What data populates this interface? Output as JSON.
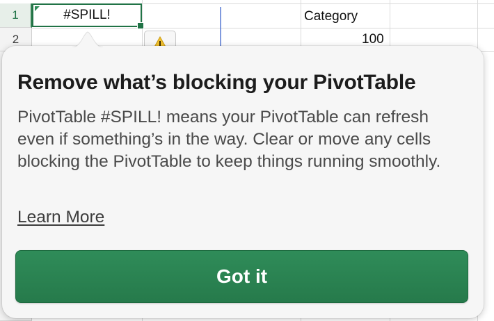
{
  "sheet": {
    "row_numbers": [
      "1",
      "2"
    ],
    "active_cell_value": "#SPILL!",
    "header_cell": "Category",
    "value_cell": "100"
  },
  "icons": {
    "warning": "warning-icon"
  },
  "callout": {
    "title": "Remove what’s blocking your PivotTable",
    "body": "PivotTable #SPILL! means your PivotTable can refresh even if something’s in the way. Clear or move any cells blocking the PivotTable to keep things running smoothly.",
    "learn_more": "Learn More",
    "button": "Got it"
  },
  "colors": {
    "accent": "#217346",
    "button": "#2a7f4f",
    "warning": "#f2c12e"
  }
}
